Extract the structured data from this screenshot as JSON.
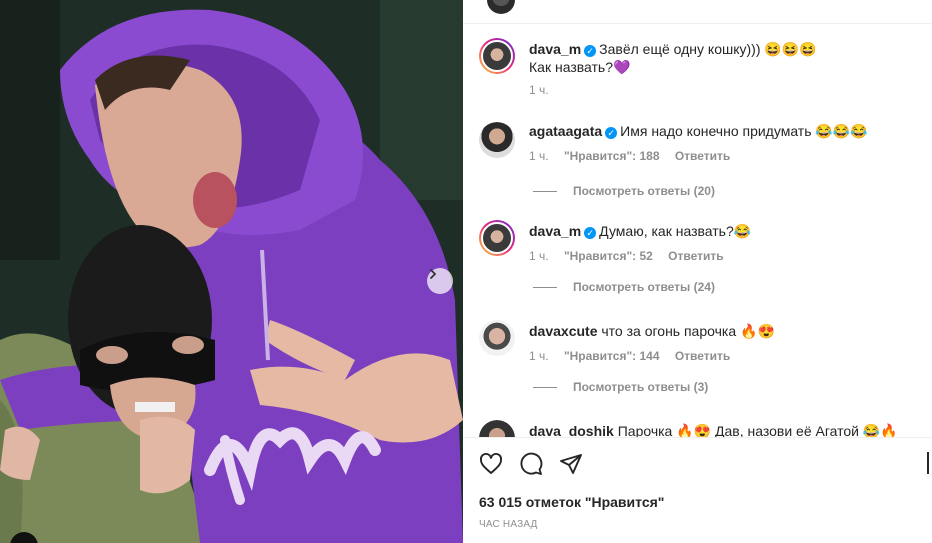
{
  "post": {
    "image_alt": "photo",
    "next_icon": "chevron-right-icon",
    "caption": {
      "username": "dava_m",
      "text_line1": "Завёл ещё одну кошку))) 😆😆😆",
      "text_line2": "Как назвать?💜",
      "time": "1 ч."
    }
  },
  "comments": [
    {
      "username": "agataagata",
      "verified": true,
      "text": "Имя надо конечно придумать 😂😂😂",
      "time": "1 ч.",
      "likes": "\"Нравится\": 188",
      "reply": "Ответить",
      "view_replies": "Посмотреть ответы (20)"
    },
    {
      "username": "dava_m",
      "verified": true,
      "text": "Думаю, как назвать?😂",
      "time": "1 ч.",
      "likes": "\"Нравится\": 52",
      "reply": "Ответить",
      "view_replies": "Посмотреть ответы (24)"
    },
    {
      "username": "davaxcute",
      "verified": false,
      "text": "что за огонь парочка 🔥😍",
      "time": "1 ч.",
      "likes": "\"Нравится\": 144",
      "reply": "Ответить",
      "view_replies": "Посмотреть ответы (3)"
    },
    {
      "username": "dava_doshik",
      "verified": false,
      "text": "Парочка 🔥😍 Дав, назови её Агатой 😂🔥"
    }
  ],
  "actions": {
    "like_icon": "heart-icon",
    "comment_icon": "comment-icon",
    "share_icon": "send-icon",
    "likes_count": "63 015 отметок \"Нравится\"",
    "time_ago": "ЧАС НАЗАД"
  },
  "colors": {
    "hoodie": "#7b3fbf",
    "verified": "#0095f6",
    "muted_text": "#8e8e8e"
  }
}
